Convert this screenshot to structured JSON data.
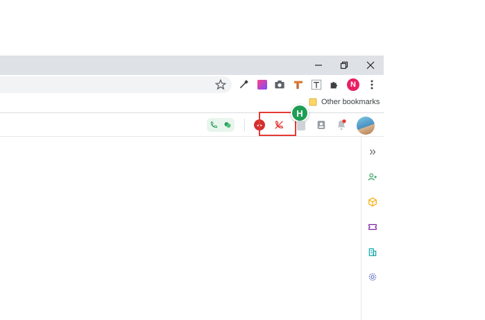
{
  "window": {
    "controls": [
      "minimize-icon",
      "restore-icon",
      "close-icon"
    ]
  },
  "toolbar": {
    "extensions": [
      "eyedropper-icon",
      "gradient-icon",
      "camera-icon",
      "pipe-icon",
      "text-format-icon",
      "puzzle-icon"
    ],
    "profile_initial": "N",
    "profile_color": "#e91e63",
    "menu_icon": "more-vert-icon"
  },
  "bookmarks": {
    "other_label": "Other bookmarks"
  },
  "app_toolbar": {
    "call_icons": [
      "phone-call-icon",
      "chat-bubbles-icon"
    ],
    "hangup_badge": "hangup-icon",
    "mute_call_icon": "call-off-icon",
    "user_initial": "H",
    "user_color": "#1e9e54",
    "highlight_color": "#e53935"
  },
  "right_rail": {
    "items": [
      "expand-icon",
      "contacts-icon",
      "cube-icon",
      "ticket-icon",
      "building-icon",
      "settings-icon"
    ]
  }
}
